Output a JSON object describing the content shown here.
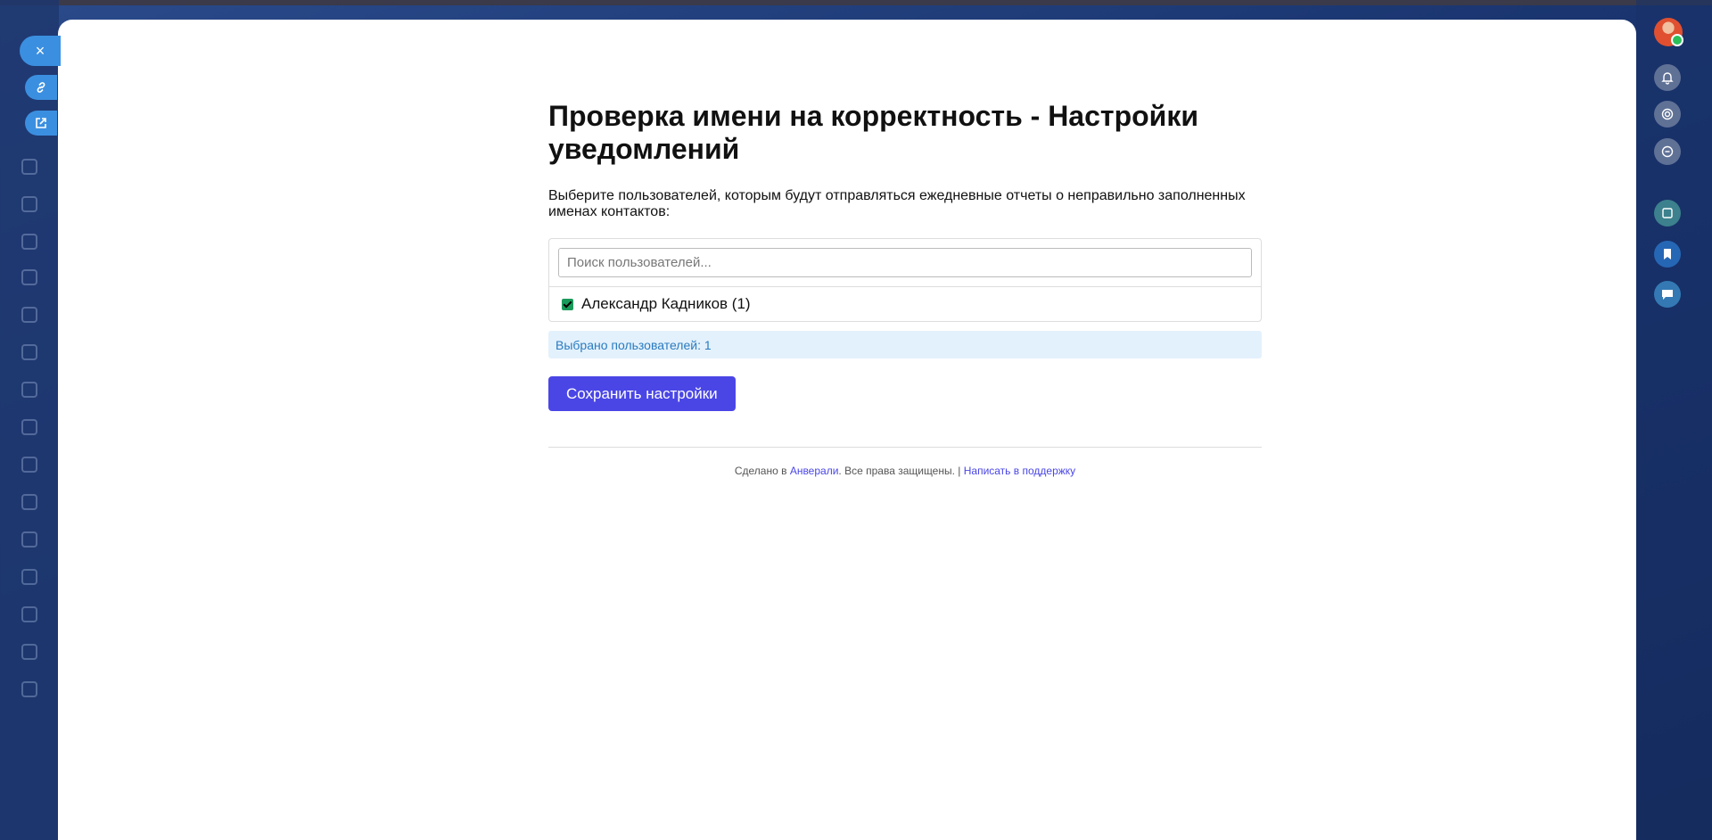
{
  "page": {
    "title": "Проверка имени на корректность - Настройки уведомлений",
    "description": "Выберите пользователей, которым будут отправляться ежедневные отчеты о неправильно заполненных именах контактов:"
  },
  "search": {
    "placeholder": "Поиск пользователей..."
  },
  "users": [
    {
      "name": "Александр Кадников (1)",
      "checked": true
    }
  ],
  "selected_info": "Выбрано пользователей: 1",
  "save_button": "Сохранить настройки",
  "footer": {
    "prefix": "Сделано в ",
    "brand_link": "Анверали",
    "middle": ". Все права защищены. | ",
    "support_link": "Написать в поддержку"
  },
  "slider": {
    "close_glyph": "×"
  },
  "colors": {
    "accent": "#4a46e6",
    "info_bg": "#e3f1fc",
    "info_text": "#2a7bbf",
    "checkbox": "#1a9a5a"
  }
}
